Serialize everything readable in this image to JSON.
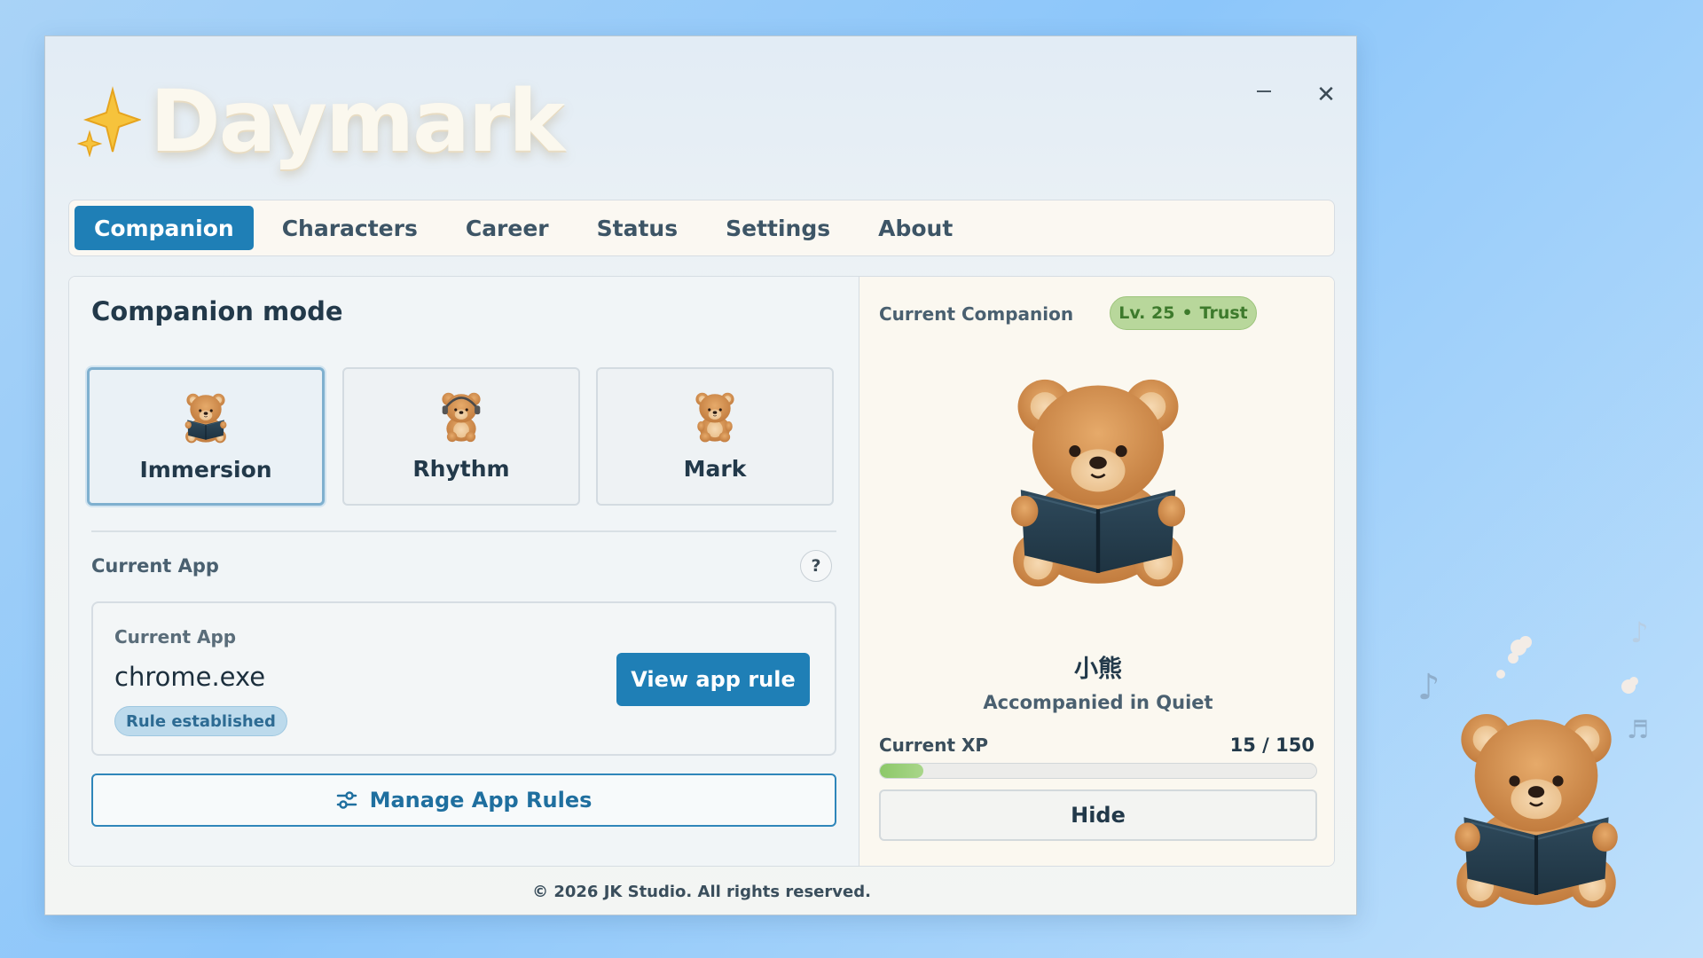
{
  "app": {
    "title": "Daymark"
  },
  "window_controls": {
    "minimize_icon": "minimize-icon",
    "close_icon": "close-icon",
    "close_glyph": "✕"
  },
  "tabs": [
    {
      "label": "Companion",
      "active": true
    },
    {
      "label": "Characters",
      "active": false
    },
    {
      "label": "Career",
      "active": false
    },
    {
      "label": "Status",
      "active": false
    },
    {
      "label": "Settings",
      "active": false
    },
    {
      "label": "About",
      "active": false
    }
  ],
  "companion_mode": {
    "title": "Companion mode",
    "modes": [
      {
        "label": "Immersion",
        "icon": "bear-reading-icon",
        "selected": true
      },
      {
        "label": "Rhythm",
        "icon": "bear-headphones-icon",
        "selected": false
      },
      {
        "label": "Mark",
        "icon": "bear-sitting-icon",
        "selected": false
      }
    ]
  },
  "current_app": {
    "section_label": "Current App",
    "help_label": "?",
    "card_label": "Current App",
    "app_name": "chrome.exe",
    "rule_status": "Rule established",
    "view_button": "View app rule",
    "manage_button": "Manage App Rules",
    "manage_icon": "sliders-icon"
  },
  "companion": {
    "section_label": "Current Companion",
    "level": "Lv. 25",
    "level_separator": "•",
    "trust": "Trust",
    "name": "小熊",
    "status": "Accompanied in Quiet",
    "xp_label": "Current XP",
    "xp_text": "15 / 150",
    "xp_current": 15,
    "xp_max": 150,
    "hide_button": "Hide"
  },
  "footer": {
    "copyright": "© 2026 JK Studio. All rights reserved."
  },
  "colors": {
    "accent": "#1f7fb6",
    "trust_badge": "#b8d79b",
    "xp_fill": "#8cc868"
  }
}
